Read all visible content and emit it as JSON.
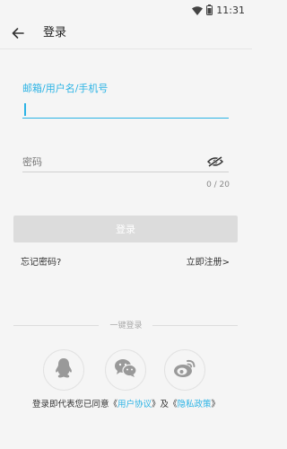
{
  "status_bar": {
    "time": "11:31"
  },
  "app_bar": {
    "title": "登录"
  },
  "form": {
    "username_label": "邮箱/用户名/手机号",
    "username_value": "",
    "password_placeholder": "密码",
    "password_counter": "0 / 20",
    "login_button": "登录"
  },
  "links": {
    "forgot_password": "忘记密码?",
    "register": "立即注册>"
  },
  "one_click": {
    "label": "一键登录"
  },
  "agreement": {
    "prefix": "登录即代表您已同意《",
    "user_agreement": "用户协议",
    "middle": "》及《",
    "privacy_policy": "隐私政策",
    "suffix": "》"
  },
  "colors": {
    "accent": "#2bb3e5",
    "disabled_button": "#dcdcdc",
    "background": "#f5f5f5"
  },
  "icons": {
    "back": "back-arrow-icon",
    "eye": "eye-off-icon",
    "qq": "qq-icon",
    "wechat": "wechat-icon",
    "weibo": "weibo-icon"
  }
}
